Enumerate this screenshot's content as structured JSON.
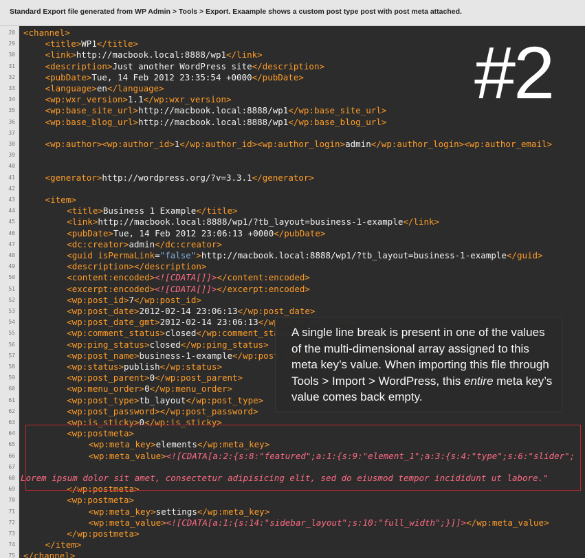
{
  "caption": "Standard Export file generated from WP Admin > Tools > Export. Exaample shows a custom post type post with post meta attached.",
  "big_number": "#2",
  "note": {
    "part1": "A single line break is present in one of the values of the multi-dimensional array assigned to this meta key’s value. When importing this file through Tools > Import > WordPress, this ",
    "emphasis": "entire",
    "part2": " meta key’s value comes back empty."
  },
  "lines": [
    {
      "n": "28",
      "indent": 0,
      "segs": [
        {
          "c": "t",
          "s": "<channel>"
        }
      ]
    },
    {
      "n": "29",
      "indent": 4,
      "segs": [
        {
          "c": "t",
          "s": "<title>"
        },
        {
          "c": "v",
          "s": "WP1"
        },
        {
          "c": "t",
          "s": "</title>"
        }
      ]
    },
    {
      "n": "30",
      "indent": 4,
      "segs": [
        {
          "c": "t",
          "s": "<link>"
        },
        {
          "c": "v",
          "s": "http://macbook.local:8888/wp1"
        },
        {
          "c": "t",
          "s": "</link>"
        }
      ]
    },
    {
      "n": "31",
      "indent": 4,
      "segs": [
        {
          "c": "t",
          "s": "<description>"
        },
        {
          "c": "v",
          "s": "Just another WordPress site"
        },
        {
          "c": "t",
          "s": "</description>"
        }
      ]
    },
    {
      "n": "32",
      "indent": 4,
      "segs": [
        {
          "c": "t",
          "s": "<pubDate>"
        },
        {
          "c": "v",
          "s": "Tue, 14 Feb 2012 23:35:54 +0000"
        },
        {
          "c": "t",
          "s": "</pubDate>"
        }
      ]
    },
    {
      "n": "33",
      "indent": 4,
      "segs": [
        {
          "c": "t",
          "s": "<language>"
        },
        {
          "c": "v",
          "s": "en"
        },
        {
          "c": "t",
          "s": "</language>"
        }
      ]
    },
    {
      "n": "34",
      "indent": 4,
      "segs": [
        {
          "c": "t",
          "s": "<wp:wxr_version>"
        },
        {
          "c": "v",
          "s": "1.1"
        },
        {
          "c": "t",
          "s": "</wp:wxr_version>"
        }
      ]
    },
    {
      "n": "35",
      "indent": 4,
      "segs": [
        {
          "c": "t",
          "s": "<wp:base_site_url>"
        },
        {
          "c": "v",
          "s": "http://macbook.local:8888/wp1"
        },
        {
          "c": "t",
          "s": "</wp:base_site_url>"
        }
      ]
    },
    {
      "n": "36",
      "indent": 4,
      "segs": [
        {
          "c": "t",
          "s": "<wp:base_blog_url>"
        },
        {
          "c": "v",
          "s": "http://macbook.local:8888/wp1"
        },
        {
          "c": "t",
          "s": "</wp:base_blog_url>"
        }
      ]
    },
    {
      "n": "37",
      "indent": 0,
      "segs": []
    },
    {
      "n": "38",
      "indent": 4,
      "segs": [
        {
          "c": "t",
          "s": "<wp:author>"
        },
        {
          "c": "t",
          "s": "<wp:author_id>"
        },
        {
          "c": "v",
          "s": "1"
        },
        {
          "c": "t",
          "s": "</wp:author_id>"
        },
        {
          "c": "t",
          "s": "<wp:author_login>"
        },
        {
          "c": "v",
          "s": "admin"
        },
        {
          "c": "t",
          "s": "</wp:author_login>"
        },
        {
          "c": "t",
          "s": "<wp:author_email>"
        }
      ]
    },
    {
      "n": "39",
      "indent": 0,
      "segs": []
    },
    {
      "n": "40",
      "indent": 0,
      "segs": []
    },
    {
      "n": "41",
      "indent": 4,
      "segs": [
        {
          "c": "t",
          "s": "<generator>"
        },
        {
          "c": "v",
          "s": "http://wordpress.org/?v=3.3.1"
        },
        {
          "c": "t",
          "s": "</generator>"
        }
      ]
    },
    {
      "n": "42",
      "indent": 0,
      "segs": []
    },
    {
      "n": "43",
      "indent": 4,
      "segs": [
        {
          "c": "t",
          "s": "<item>"
        }
      ]
    },
    {
      "n": "44",
      "indent": 8,
      "segs": [
        {
          "c": "t",
          "s": "<title>"
        },
        {
          "c": "v",
          "s": "Business 1 Example"
        },
        {
          "c": "t",
          "s": "</title>"
        }
      ]
    },
    {
      "n": "45",
      "indent": 8,
      "segs": [
        {
          "c": "t",
          "s": "<link>"
        },
        {
          "c": "v",
          "s": "http://macbook.local:8888/wp1/?tb_layout=business-1-example"
        },
        {
          "c": "t",
          "s": "</link>"
        }
      ]
    },
    {
      "n": "46",
      "indent": 8,
      "segs": [
        {
          "c": "t",
          "s": "<pubDate>"
        },
        {
          "c": "v",
          "s": "Tue, 14 Feb 2012 23:06:13 +0000"
        },
        {
          "c": "t",
          "s": "</pubDate>"
        }
      ]
    },
    {
      "n": "47",
      "indent": 8,
      "segs": [
        {
          "c": "t",
          "s": "<dc:creator>"
        },
        {
          "c": "v",
          "s": "admin"
        },
        {
          "c": "t",
          "s": "</dc:creator>"
        }
      ]
    },
    {
      "n": "48",
      "indent": 8,
      "segs": [
        {
          "c": "t",
          "s": "<guid "
        },
        {
          "c": "attr",
          "s": "isPermaLink"
        },
        {
          "c": "v",
          "s": "="
        },
        {
          "c": "str",
          "s": "\"false\""
        },
        {
          "c": "t",
          "s": ">"
        },
        {
          "c": "v",
          "s": "http://macbook.local:8888/wp1/?tb_layout=business-1-example"
        },
        {
          "c": "t",
          "s": "</guid>"
        }
      ]
    },
    {
      "n": "49",
      "indent": 8,
      "segs": [
        {
          "c": "t",
          "s": "<description>"
        },
        {
          "c": "t",
          "s": "</description>"
        }
      ]
    },
    {
      "n": "50",
      "indent": 8,
      "segs": [
        {
          "c": "t",
          "s": "<content:encoded>"
        },
        {
          "c": "cdata",
          "s": "<![CDATA[]]>"
        },
        {
          "c": "t",
          "s": "</content:encoded>"
        }
      ]
    },
    {
      "n": "51",
      "indent": 8,
      "segs": [
        {
          "c": "t",
          "s": "<excerpt:encoded>"
        },
        {
          "c": "cdata",
          "s": "<![CDATA[]]>"
        },
        {
          "c": "t",
          "s": "</excerpt:encoded>"
        }
      ]
    },
    {
      "n": "52",
      "indent": 8,
      "segs": [
        {
          "c": "t",
          "s": "<wp:post_id>"
        },
        {
          "c": "v",
          "s": "7"
        },
        {
          "c": "t",
          "s": "</wp:post_id>"
        }
      ]
    },
    {
      "n": "53",
      "indent": 8,
      "segs": [
        {
          "c": "t",
          "s": "<wp:post_date>"
        },
        {
          "c": "v",
          "s": "2012-02-14 23:06:13"
        },
        {
          "c": "t",
          "s": "</wp:post_date>"
        }
      ]
    },
    {
      "n": "54",
      "indent": 8,
      "segs": [
        {
          "c": "t",
          "s": "<wp:post_date_gmt>"
        },
        {
          "c": "v",
          "s": "2012-02-14 23:06:13"
        },
        {
          "c": "t",
          "s": "</wp:post_date_gmt>"
        }
      ]
    },
    {
      "n": "55",
      "indent": 8,
      "segs": [
        {
          "c": "t",
          "s": "<wp:comment_status>"
        },
        {
          "c": "v",
          "s": "closed"
        },
        {
          "c": "t",
          "s": "</wp:comment_status>"
        }
      ]
    },
    {
      "n": "56",
      "indent": 8,
      "segs": [
        {
          "c": "t",
          "s": "<wp:ping_status>"
        },
        {
          "c": "v",
          "s": "closed"
        },
        {
          "c": "t",
          "s": "</wp:ping_status>"
        }
      ]
    },
    {
      "n": "57",
      "indent": 8,
      "segs": [
        {
          "c": "t",
          "s": "<wp:post_name>"
        },
        {
          "c": "v",
          "s": "business-1-example"
        },
        {
          "c": "t",
          "s": "</wp:post_name>"
        }
      ]
    },
    {
      "n": "58",
      "indent": 8,
      "segs": [
        {
          "c": "t",
          "s": "<wp:status>"
        },
        {
          "c": "v",
          "s": "publish"
        },
        {
          "c": "t",
          "s": "</wp:status>"
        }
      ]
    },
    {
      "n": "59",
      "indent": 8,
      "segs": [
        {
          "c": "t",
          "s": "<wp:post_parent>"
        },
        {
          "c": "v",
          "s": "0"
        },
        {
          "c": "t",
          "s": "</wp:post_parent>"
        }
      ]
    },
    {
      "n": "60",
      "indent": 8,
      "segs": [
        {
          "c": "t",
          "s": "<wp:menu_order>"
        },
        {
          "c": "v",
          "s": "0"
        },
        {
          "c": "t",
          "s": "</wp:menu_order>"
        }
      ]
    },
    {
      "n": "61",
      "indent": 8,
      "segs": [
        {
          "c": "t",
          "s": "<wp:post_type>"
        },
        {
          "c": "v",
          "s": "tb_layout"
        },
        {
          "c": "t",
          "s": "</wp:post_type>"
        }
      ]
    },
    {
      "n": "62",
      "indent": 8,
      "segs": [
        {
          "c": "t",
          "s": "<wp:post_password>"
        },
        {
          "c": "t",
          "s": "</wp:post_password>"
        }
      ]
    },
    {
      "n": "63",
      "indent": 8,
      "segs": [
        {
          "c": "t",
          "s": "<wp:is_sticky>"
        },
        {
          "c": "v",
          "s": "0"
        },
        {
          "c": "t",
          "s": "</wp:is_sticky>"
        }
      ]
    },
    {
      "n": "64",
      "indent": 8,
      "segs": [
        {
          "c": "t",
          "s": "<wp:postmeta>"
        }
      ]
    },
    {
      "n": "65",
      "indent": 12,
      "segs": [
        {
          "c": "t",
          "s": "<wp:meta_key>"
        },
        {
          "c": "v",
          "s": "elements"
        },
        {
          "c": "t",
          "s": "</wp:meta_key>"
        }
      ]
    },
    {
      "n": "66",
      "indent": 12,
      "segs": [
        {
          "c": "t",
          "s": "<wp:meta_value>"
        },
        {
          "c": "cdata",
          "s": "<![CDATA[a:2:{s:8:\"featured\";a:1:{s:9:\"element_1\";a:3:{s:4:\"type\";s:6:\"slider\";"
        }
      ]
    },
    {
      "n": "67",
      "indent": 0,
      "segs": []
    },
    {
      "n": "68",
      "indent": -0.5,
      "segs": [
        {
          "c": "cdata",
          "s": "Lorem ipsum dolor sit amet, consectetur adipisicing elit, sed do eiusmod tempor incididunt ut labore.\""
        }
      ]
    },
    {
      "n": "69",
      "indent": 8,
      "segs": [
        {
          "c": "t",
          "s": "</wp:postmeta>"
        }
      ]
    },
    {
      "n": "70",
      "indent": 8,
      "segs": [
        {
          "c": "t",
          "s": "<wp:postmeta>"
        }
      ]
    },
    {
      "n": "71",
      "indent": 12,
      "segs": [
        {
          "c": "t",
          "s": "<wp:meta_key>"
        },
        {
          "c": "v",
          "s": "settings"
        },
        {
          "c": "t",
          "s": "</wp:meta_key>"
        }
      ]
    },
    {
      "n": "72",
      "indent": 12,
      "segs": [
        {
          "c": "t",
          "s": "<wp:meta_value>"
        },
        {
          "c": "cdata",
          "s": "<![CDATA[a:1:{s:14:\"sidebar_layout\";s:10:\"full_width\";}]]>"
        },
        {
          "c": "t",
          "s": "</wp:meta_value>"
        }
      ]
    },
    {
      "n": "73",
      "indent": 8,
      "segs": [
        {
          "c": "t",
          "s": "</wp:postmeta>"
        }
      ]
    },
    {
      "n": "74",
      "indent": 4,
      "segs": [
        {
          "c": "t",
          "s": "</item>"
        }
      ]
    },
    {
      "n": "75",
      "indent": 0,
      "segs": [
        {
          "c": "t",
          "s": "</channel>"
        }
      ]
    }
  ]
}
